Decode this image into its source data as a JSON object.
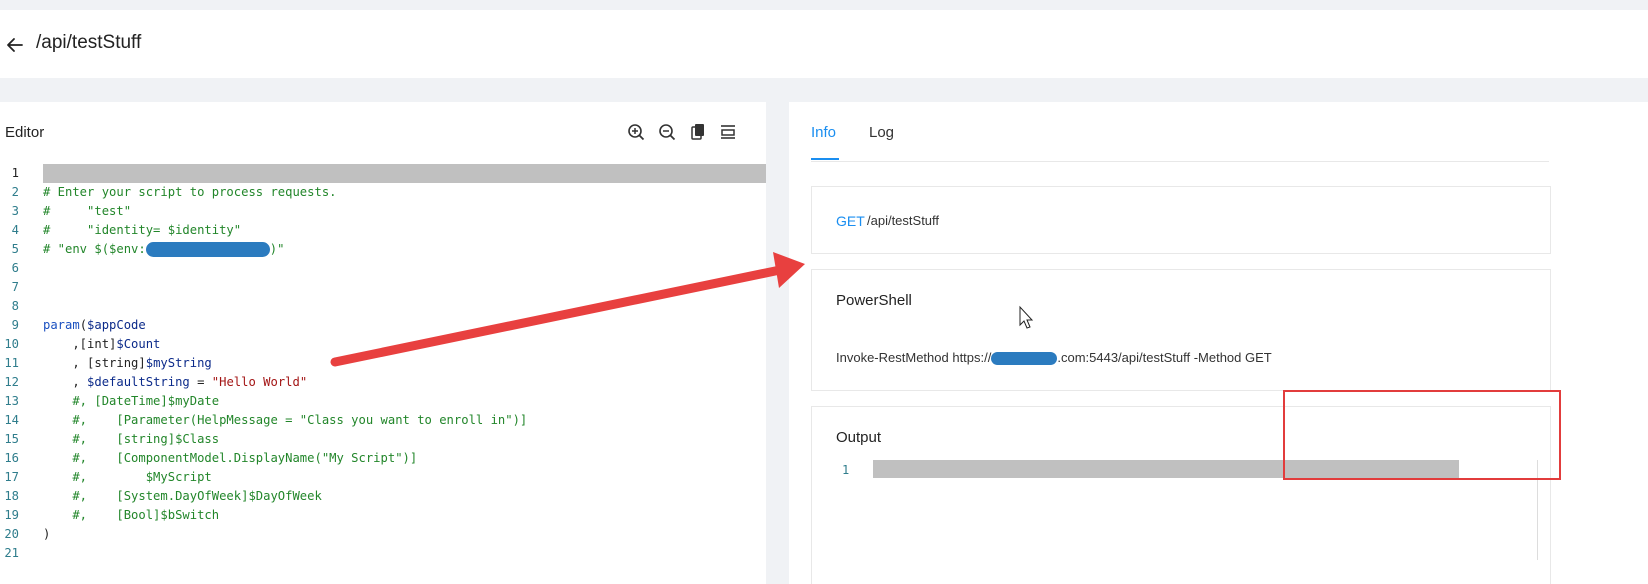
{
  "header": {
    "title": "/api/testStuff"
  },
  "editor": {
    "title": "Editor",
    "toolbar": [
      "zoom-in-icon",
      "zoom-out-icon",
      "copy-icon",
      "format-icon"
    ],
    "lines": [
      {
        "n": "1",
        "segments": []
      },
      {
        "n": "2",
        "segments": [
          {
            "c": "c",
            "t": "# Enter your script to process requests."
          }
        ]
      },
      {
        "n": "3",
        "segments": [
          {
            "c": "c",
            "t": "#     \"test\""
          }
        ]
      },
      {
        "n": "4",
        "segments": [
          {
            "c": "c",
            "t": "#     \"identity= $identity\""
          }
        ]
      },
      {
        "n": "5",
        "segments": [
          {
            "c": "c",
            "t": "# \"env $($env:"
          },
          {
            "redact": 124
          },
          {
            "c": "c",
            "t": ")\""
          }
        ]
      },
      {
        "n": "6",
        "segments": []
      },
      {
        "n": "7",
        "segments": []
      },
      {
        "n": "8",
        "segments": []
      },
      {
        "n": "9",
        "segments": [
          {
            "c": "k",
            "t": "param"
          },
          {
            "c": "d",
            "t": "("
          },
          {
            "c": "v",
            "t": "$appCode"
          }
        ]
      },
      {
        "n": "10",
        "segments": [
          {
            "c": "d",
            "t": "    ,[int]"
          },
          {
            "c": "v",
            "t": "$Count"
          }
        ]
      },
      {
        "n": "11",
        "segments": [
          {
            "c": "d",
            "t": "    , [string]"
          },
          {
            "c": "v",
            "t": "$myString"
          }
        ]
      },
      {
        "n": "12",
        "segments": [
          {
            "c": "d",
            "t": "    , "
          },
          {
            "c": "v",
            "t": "$defaultString"
          },
          {
            "c": "d",
            "t": " = "
          },
          {
            "c": "s",
            "t": "\"Hello World\""
          }
        ]
      },
      {
        "n": "13",
        "segments": [
          {
            "c": "c",
            "t": "    #, [DateTime]$myDate"
          }
        ]
      },
      {
        "n": "14",
        "segments": [
          {
            "c": "c",
            "t": "    #,    [Parameter(HelpMessage = \"Class you want to enroll in\")]"
          }
        ]
      },
      {
        "n": "15",
        "segments": [
          {
            "c": "c",
            "t": "    #,    [string]$Class"
          }
        ]
      },
      {
        "n": "16",
        "segments": [
          {
            "c": "c",
            "t": "    #,    [ComponentModel.DisplayName(\"My Script\")]"
          }
        ]
      },
      {
        "n": "17",
        "segments": [
          {
            "c": "c",
            "t": "    #,        $MyScript"
          }
        ]
      },
      {
        "n": "18",
        "segments": [
          {
            "c": "c",
            "t": "    #,    [System.DayOfWeek]$DayOfWeek"
          }
        ]
      },
      {
        "n": "19",
        "segments": [
          {
            "c": "c",
            "t": "    #,    [Bool]$bSwitch"
          }
        ]
      },
      {
        "n": "20",
        "segments": [
          {
            "c": "d",
            "t": ")"
          }
        ]
      },
      {
        "n": "21",
        "segments": []
      }
    ]
  },
  "tabs": {
    "info": "Info",
    "log": "Log"
  },
  "endpoint": {
    "method": "GET",
    "path": "/api/testStuff"
  },
  "powershell": {
    "title": "PowerShell",
    "cmd_prefix": "Invoke-RestMethod https://",
    "cmd_suffix": ".com:5443/api/testStuff -Method GET"
  },
  "output": {
    "title": "Output",
    "line": "1"
  },
  "colors": {
    "accent": "#1a8ef0",
    "arrow": "#e8403f",
    "redaction": "#2b7bbf"
  }
}
